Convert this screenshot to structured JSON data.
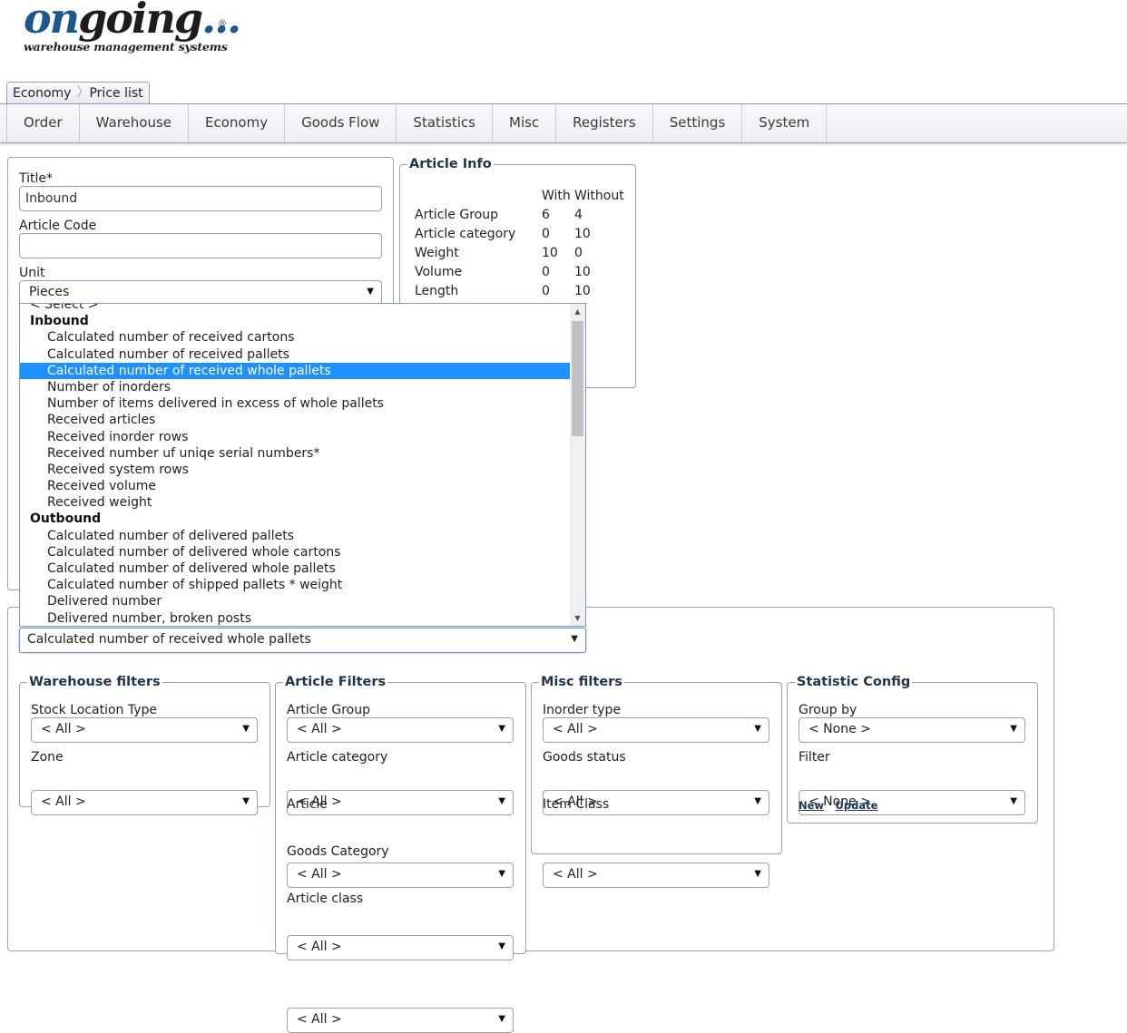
{
  "logo": {
    "on": "on",
    "going": "going",
    "dots": "...",
    "registered": "®",
    "subtitle": "warehouse management systems"
  },
  "breadcrumb": [
    "Economy",
    "Price list"
  ],
  "nav": [
    "Order",
    "Warehouse",
    "Economy",
    "Goods Flow",
    "Statistics",
    "Misc",
    "Registers",
    "Settings",
    "System"
  ],
  "form": {
    "title_label": "Title*",
    "title_value": "Inbound",
    "article_code_label": "Article Code",
    "article_code_value": "",
    "unit_label": "Unit",
    "unit_value": "Pieces"
  },
  "article_info": {
    "legend": "Article Info",
    "col_with": "With",
    "col_without": "Without",
    "rows": [
      {
        "name": "Article Group",
        "with": "6",
        "without": "4"
      },
      {
        "name": "Article category",
        "with": "0",
        "without": "10"
      },
      {
        "name": "Weight",
        "with": "10",
        "without": "0"
      },
      {
        "name": "Volume",
        "with": "0",
        "without": "10"
      },
      {
        "name": "Length",
        "with": "0",
        "without": "10"
      }
    ]
  },
  "dropdown": {
    "partial_top": "< Select >",
    "options": [
      {
        "label": "Inbound",
        "group": true
      },
      {
        "label": "Calculated number of received cartons"
      },
      {
        "label": "Calculated number of received pallets"
      },
      {
        "label": "Calculated number of received whole pallets",
        "selected": true
      },
      {
        "label": "Number of inorders"
      },
      {
        "label": "Number of items delivered in excess of whole pallets"
      },
      {
        "label": "Received articles"
      },
      {
        "label": "Received inorder rows"
      },
      {
        "label": "Received number uf uniqe serial numbers*"
      },
      {
        "label": "Received system rows"
      },
      {
        "label": "Received volume"
      },
      {
        "label": "Received weight"
      },
      {
        "label": "Outbound",
        "group": true
      },
      {
        "label": "Calculated number of delivered pallets"
      },
      {
        "label": "Calculated number of delivered whole cartons"
      },
      {
        "label": "Calculated number of delivered whole pallets"
      },
      {
        "label": "Calculated number of shipped pallets * weight"
      },
      {
        "label": "Delivered number"
      },
      {
        "label": "Delivered number, broken posts"
      }
    ],
    "selected_value": "Calculated number of received whole pallets"
  },
  "warehouse_filters": {
    "legend": "Warehouse filters",
    "fields": [
      {
        "label": "Stock Location Type",
        "value": "< All >"
      },
      {
        "label": "Zone",
        "value": "< All >"
      }
    ]
  },
  "article_filters": {
    "legend": "Article Filters",
    "fields": [
      {
        "label": "Article Group",
        "value": "< All >"
      },
      {
        "label": "Article category",
        "value": "< All >"
      },
      {
        "label": "Article",
        "value": "< All >"
      },
      {
        "label": "Goods Category",
        "value": "< All >"
      },
      {
        "label": "Article class",
        "value": "< All >"
      }
    ]
  },
  "misc_filters": {
    "legend": "Misc filters",
    "fields": [
      {
        "label": "Inorder type",
        "value": "< All >"
      },
      {
        "label": "Goods status",
        "value": "< All >"
      },
      {
        "label": "Item Class",
        "value": "< All >"
      }
    ]
  },
  "statistic_config": {
    "legend": "Statistic Config",
    "fields": [
      {
        "label": "Group by",
        "value": "< None >"
      },
      {
        "label": "Filter",
        "value": "< None >"
      }
    ],
    "links": [
      "New",
      "Update"
    ]
  },
  "icons": {
    "dropdown_arrow": "▼",
    "scroll_up": "▲",
    "scroll_down": "▼",
    "crumb_sep": "〉"
  }
}
